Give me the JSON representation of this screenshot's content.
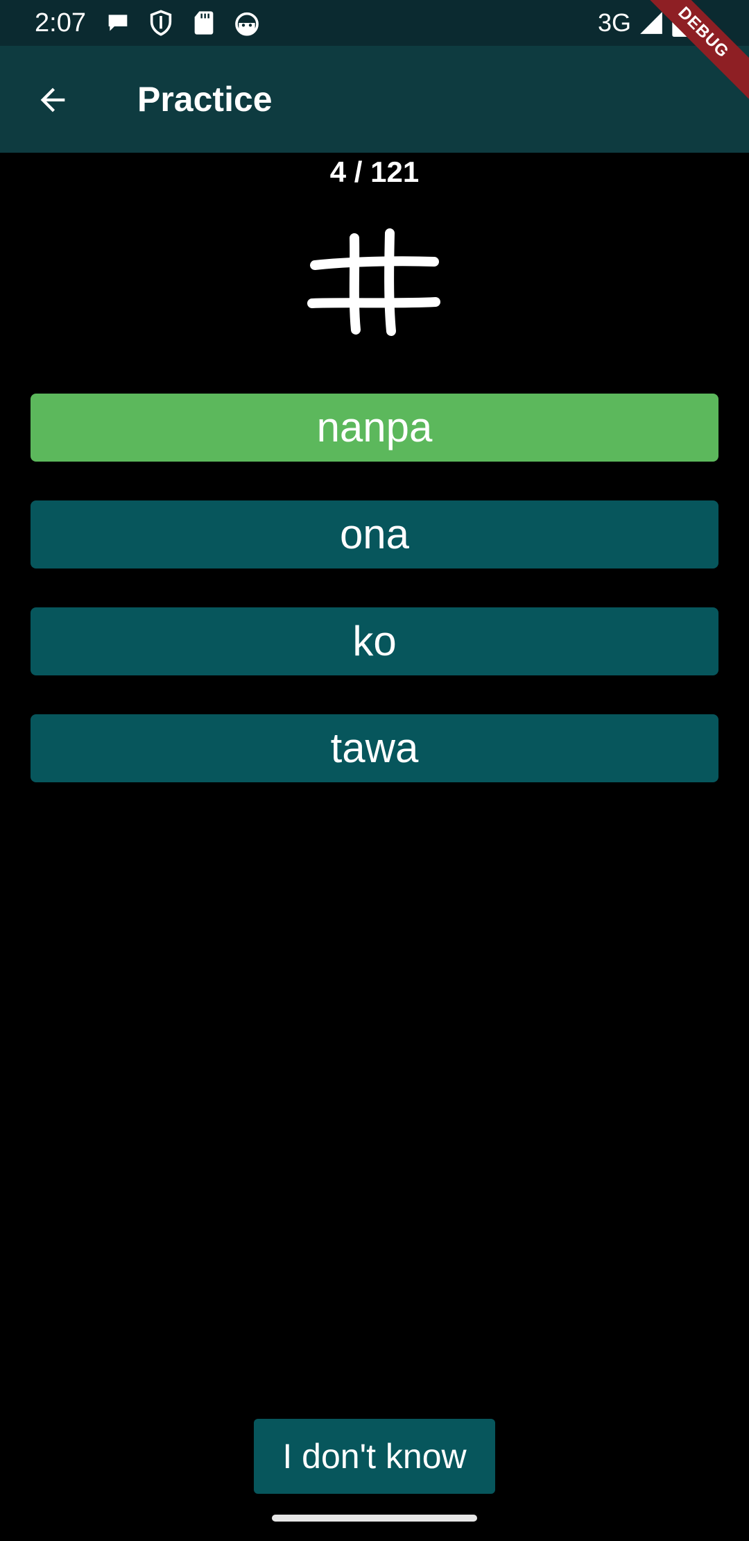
{
  "status_bar": {
    "time": "2:07",
    "network": "3G",
    "icons_left": [
      "chat-bubble-icon",
      "shield-icon",
      "sd-card-icon",
      "android-head-icon"
    ],
    "icons_right": [
      "signal-icon",
      "battery-icon"
    ]
  },
  "debug_banner": {
    "label": "DEBUG"
  },
  "app_bar": {
    "title": "Practice",
    "back_icon": "arrow-back-icon"
  },
  "progress": {
    "text": "4 / 121",
    "current": 4,
    "total": 121
  },
  "glyph": {
    "icon": "nanpa-glyph-icon"
  },
  "options": [
    {
      "label": "nanpa",
      "state": "correct"
    },
    {
      "label": "ona",
      "state": "default"
    },
    {
      "label": "ko",
      "state": "default"
    },
    {
      "label": "tawa",
      "state": "default"
    }
  ],
  "dont_know": {
    "label": "I don't know"
  },
  "colors": {
    "status_bar_bg": "#0b2a30",
    "app_bar_bg": "#0e3b40",
    "background": "#000000",
    "option_bg": "#07565c",
    "correct_bg": "#5cb85c",
    "debug_ribbon": "#8e1f24",
    "text": "#ffffff"
  }
}
